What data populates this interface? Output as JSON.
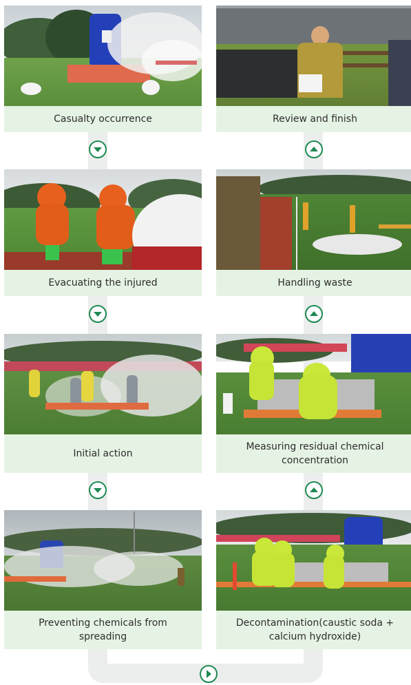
{
  "steps": {
    "casualty": "Casualty occurrence",
    "evacuating": "Evacuating the injured",
    "initial": "Initial action",
    "preventing": "Preventing chemicals from spreading",
    "decontamination": "Decontamination(caustic soda + calcium hydroxide)",
    "measuring": "Measuring residual chemical concentration",
    "handling": "Handling waste",
    "review": "Review and finish"
  },
  "icons": {
    "down": "chevron-down-circle-icon",
    "up": "chevron-up-circle-icon",
    "right": "chevron-right-circle-icon"
  },
  "colors": {
    "caption_bg": "#e5f3e4",
    "arrow_green": "#1d8a52",
    "track": "#eceeed"
  }
}
